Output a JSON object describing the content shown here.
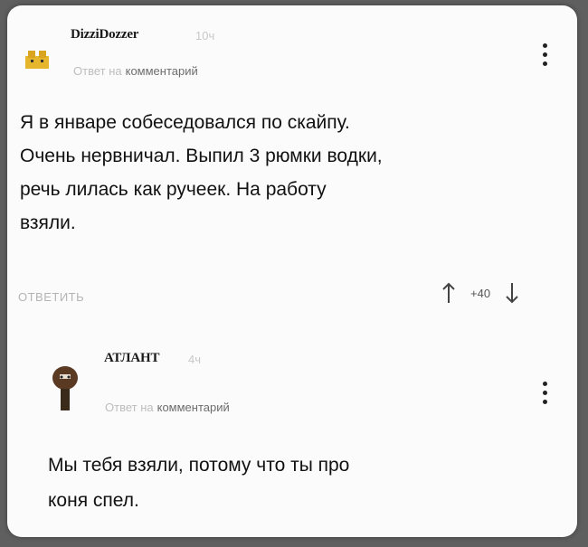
{
  "comment1": {
    "username": "DizziDozzer",
    "time": "10ч",
    "reply_prefix": "Ответ на",
    "reply_target": "комментарий",
    "text_lines": [
      "Я в январе собеседовался по скайпу.",
      "Очень нервничал. Выпил 3 рюмки водки,",
      "речь лилась как ручеек. На работу",
      "взяли."
    ],
    "reply_button": "ОТВЕТИТЬ",
    "score": "+40",
    "up_icon": "arrow-up-icon",
    "down_icon": "arrow-down-icon",
    "menu_icon": "more-vertical-icon"
  },
  "comment2": {
    "username": "АТЛАНТ",
    "time": "4ч",
    "reply_prefix": "Ответ на",
    "reply_target": "комментарий",
    "text_lines": [
      "Мы тебя взяли, потому что ты про",
      "коня спел."
    ],
    "menu_icon": "more-vertical-icon"
  }
}
